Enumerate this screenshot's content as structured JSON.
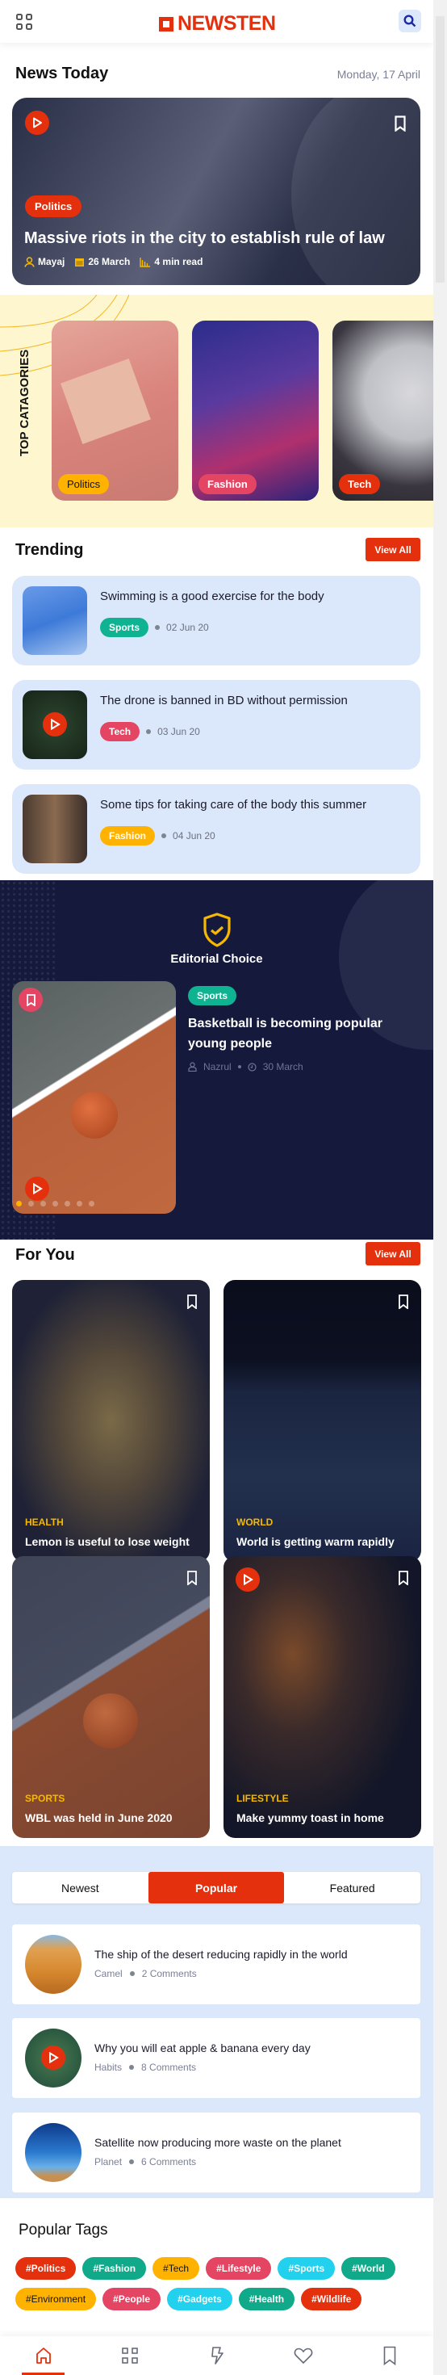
{
  "header": {
    "logo": "NEWSTEN",
    "menu_icon": "grid-icon",
    "search_icon": "search-icon"
  },
  "colors": {
    "accent": "#e5300e",
    "yellow": "#ffb300",
    "green": "#10b391",
    "pink": "#e44563",
    "cyan": "#22d1ee",
    "navy": "#151a3d"
  },
  "news_today": {
    "title": "News Today",
    "date": "Monday, 17 April",
    "hero": {
      "category": "Politics",
      "headline": "Massive riots in the city to establish rule of law",
      "author": "Mayaj",
      "date": "26 March",
      "read_time": "4 min read"
    }
  },
  "top_categories": {
    "title": "TOP CATAGORIES",
    "items": [
      {
        "label": "Politics"
      },
      {
        "label": "Fashion"
      },
      {
        "label": "Tech"
      }
    ]
  },
  "trending": {
    "title": "Trending",
    "view_all": "View All",
    "items": [
      {
        "title": "Swimming is a good exercise for the body",
        "category": "Sports",
        "date": "02 Jun 20"
      },
      {
        "title": "The drone is banned in BD without permission",
        "category": "Tech",
        "date": "03 Jun 20"
      },
      {
        "title": "Some tips for taking care of the body this summer",
        "category": "Fashion",
        "date": "04 Jun 20"
      }
    ]
  },
  "editorial": {
    "title": "Editorial Choice",
    "category": "Sports",
    "headline": "Basketball is becoming popular young people",
    "author": "Nazrul",
    "date": "30 March",
    "slides": 7,
    "active_slide": 1
  },
  "for_you": {
    "title": "For You",
    "view_all": "View All",
    "items": [
      {
        "category": "HEALTH",
        "title": "Lemon is useful to lose weight"
      },
      {
        "category": "WORLD",
        "title": "World is getting warm rapidly"
      },
      {
        "category": "SPORTS",
        "title": "WBL was held in June 2020"
      },
      {
        "category": "LIFESTYLE",
        "title": "Make yummy toast in home"
      }
    ]
  },
  "tabs": {
    "items": [
      "Newest",
      "Popular",
      "Featured"
    ],
    "active": "Popular",
    "list": [
      {
        "title": "The ship of the desert reducing rapidly in the world",
        "tag": "Camel",
        "comments": "2 Comments"
      },
      {
        "title": "Why you will eat apple & banana every day",
        "tag": "Habits",
        "comments": "8 Comments"
      },
      {
        "title": "Satellite now producing more waste on the planet",
        "tag": "Planet",
        "comments": "6 Comments"
      }
    ]
  },
  "popular_tags": {
    "title": "Popular Tags",
    "items": [
      "#Politics",
      "#Fashion",
      "#Tech",
      "#Lifestyle",
      "#Sports",
      "#World",
      "#Environment",
      "#People",
      "#Gadgets",
      "#Health",
      "#Wildlife"
    ]
  },
  "bottom_nav": {
    "items": [
      "home-icon",
      "grid-icon",
      "flash-icon",
      "heart-icon",
      "bookmark-icon"
    ],
    "active": "home-icon"
  }
}
